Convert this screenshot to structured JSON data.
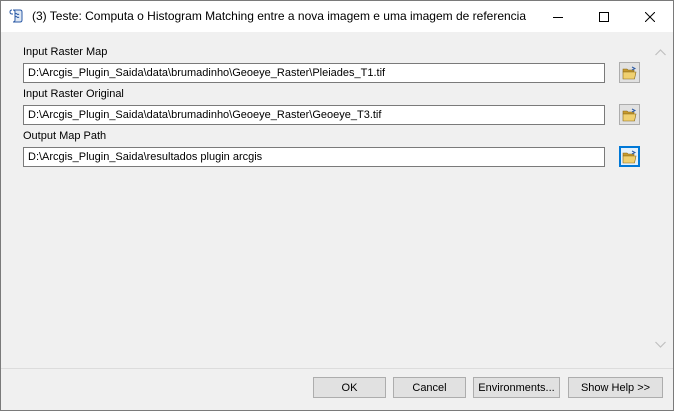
{
  "window": {
    "title": "(3) Teste: Computa o Histogram Matching entre a nova imagem e uma imagem de referencia",
    "icon": "script-tool-icon"
  },
  "fields": [
    {
      "label": "Input Raster Map",
      "value": "D:\\Arcgis_Plugin_Saida\\data\\brumadinho\\Geoeye_Raster\\Pleiades_T1.tif"
    },
    {
      "label": "Input Raster Original",
      "value": "D:\\Arcgis_Plugin_Saida\\data\\brumadinho\\Geoeye_Raster\\Geoeye_T3.tif"
    },
    {
      "label": "Output Map Path",
      "value": "D:\\Arcgis_Plugin_Saida\\resultados plugin arcgis"
    }
  ],
  "footer": {
    "ok_label": "OK",
    "cancel_label": "Cancel",
    "environments_label": "Environments...",
    "show_help_label": "Show Help >>"
  },
  "colors": {
    "focus_accent": "#0078d7",
    "folder_yellow": "#e8c050"
  }
}
